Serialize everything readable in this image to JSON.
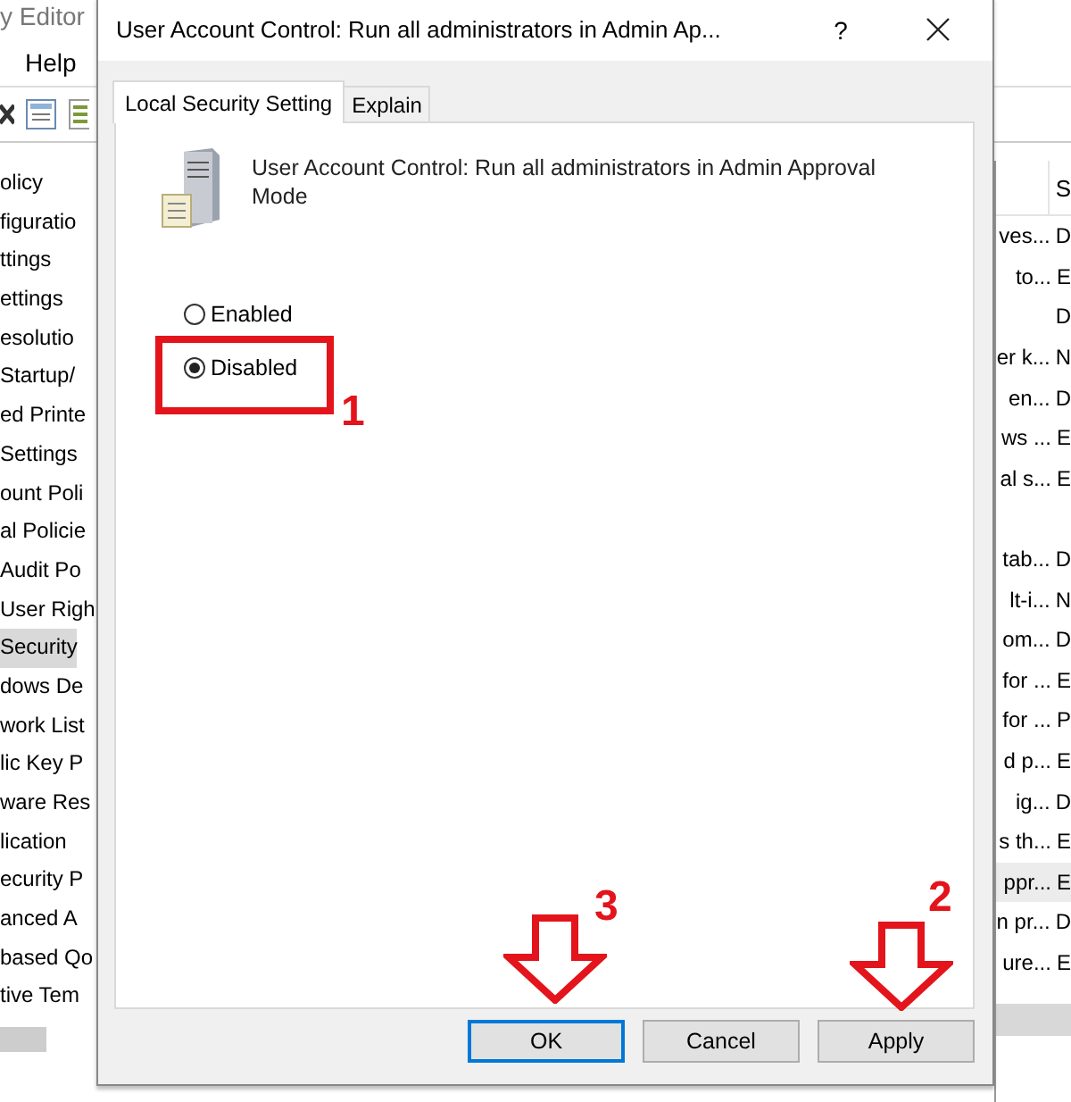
{
  "background_window": {
    "title": "y Editor",
    "menu": [
      "Help"
    ],
    "tree": [
      {
        "label": "olicy",
        "selected": false
      },
      {
        "label": "figuratio",
        "selected": false
      },
      {
        "label": "ttings",
        "selected": false
      },
      {
        "label": "ettings",
        "selected": false
      },
      {
        "label": "esolutio",
        "selected": false
      },
      {
        "label": "Startup/",
        "selected": false
      },
      {
        "label": "ed Printe",
        "selected": false
      },
      {
        "label": "Settings",
        "selected": false
      },
      {
        "label": "ount Poli",
        "selected": false
      },
      {
        "label": "al Policie",
        "selected": false
      },
      {
        "label": "Audit Po",
        "selected": false
      },
      {
        "label": "User Righ",
        "selected": false
      },
      {
        "label": "Security",
        "selected": true
      },
      {
        "label": "dows De",
        "selected": false
      },
      {
        "label": "work List",
        "selected": false
      },
      {
        "label": "lic Key P",
        "selected": false
      },
      {
        "label": "ware Res",
        "selected": false
      },
      {
        "label": "lication",
        "selected": false
      },
      {
        "label": "ecurity P",
        "selected": false
      },
      {
        "label": "anced A",
        "selected": false
      },
      {
        "label": "based Qo",
        "selected": false
      },
      {
        "label": "tive Tem",
        "selected": false
      }
    ],
    "list": {
      "columns": [
        {
          "label": "S"
        }
      ],
      "rows": [
        {
          "column_1": "ves...",
          "column_2": "D",
          "selected": false
        },
        {
          "column_1": "to...",
          "column_2": "E",
          "selected": false
        },
        {
          "column_2": "D",
          "selected": false
        },
        {
          "column_1": "er k...",
          "column_2": "N",
          "selected": false
        },
        {
          "column_1": "en...",
          "column_2": "D",
          "selected": false
        },
        {
          "column_1": "ws ...",
          "column_2": "E",
          "selected": false
        },
        {
          "column_1": "al s...",
          "column_2": "E",
          "selected": false
        },
        {
          "selected": false
        },
        {
          "column_1": "tab...",
          "column_2": "D",
          "selected": false
        },
        {
          "column_1": "lt-i...",
          "column_2": "N",
          "selected": false
        },
        {
          "column_1": "om...",
          "column_2": "D",
          "selected": false
        },
        {
          "column_1": "for ...",
          "column_2": "E",
          "selected": false
        },
        {
          "column_1": "for ...",
          "column_2": "P",
          "selected": false
        },
        {
          "column_1": "d p...",
          "column_2": "E",
          "selected": false
        },
        {
          "column_1": "ig...",
          "column_2": "D",
          "selected": false
        },
        {
          "column_1": "s th...",
          "column_2": "E",
          "selected": false
        },
        {
          "column_1": "ppr...",
          "column_2": "E",
          "selected": true
        },
        {
          "column_1": "n pr...",
          "column_2": "D",
          "selected": false
        },
        {
          "column_1": "ure...",
          "column_2": "E",
          "selected": false
        }
      ]
    }
  },
  "dialog": {
    "title": "User Account Control: Run all administrators in Admin Ap...",
    "help": "?",
    "tabs": [
      {
        "label": "Local Security Setting",
        "selected": true
      },
      {
        "label": "Explain",
        "selected": false
      }
    ],
    "policy_name": "User Account Control: Run all administrators in Admin Approval Mode",
    "options": [
      {
        "label": "Enabled",
        "selected": false
      },
      {
        "label": "Disabled",
        "selected": true
      }
    ],
    "buttons": [
      {
        "label": "OK",
        "default": true
      },
      {
        "label": "Cancel",
        "default": false
      },
      {
        "label": "Apply",
        "default": false
      }
    ]
  },
  "annotations": [
    {
      "kind": "box"
    },
    {
      "kind": "number",
      "text": "1"
    },
    {
      "kind": "arrow"
    },
    {
      "kind": "number",
      "text": "3"
    },
    {
      "kind": "arrow"
    },
    {
      "kind": "number",
      "text": "2"
    }
  ]
}
